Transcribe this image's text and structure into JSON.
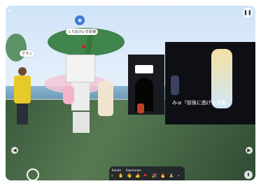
{
  "top_left_icons": [
    "menu-icon",
    "vertical-dots-icon"
  ],
  "top_right_icon": "pause-icon",
  "avatar_label": "くりおびいず彩弾",
  "signs": {
    "left_small_label": "クラン",
    "screen_caption": "みゅ『前後に曲げる運動"
  },
  "toolbar": {
    "tabs": [
      "Emote",
      "Expression"
    ],
    "emote_icons": [
      "‹",
      "✋",
      "👋",
      "👍",
      "❤",
      "🎉",
      "🔥",
      "🙏",
      "›"
    ],
    "bottom_icons": [
      "👤",
      "📷",
      "⚙",
      "🏠",
      "🎥"
    ]
  }
}
